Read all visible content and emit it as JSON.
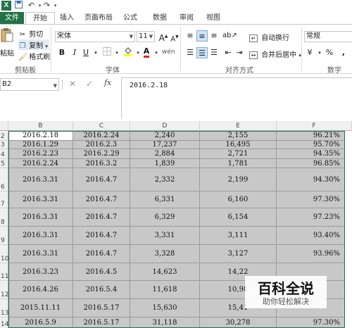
{
  "qat": {
    "undo": "↶",
    "redo": "↷"
  },
  "tabs": [
    {
      "label": "文件"
    },
    {
      "label": "开始"
    },
    {
      "label": "插入"
    },
    {
      "label": "页面布局"
    },
    {
      "label": "公式"
    },
    {
      "label": "数据"
    },
    {
      "label": "审阅"
    },
    {
      "label": "视图"
    }
  ],
  "ribbon": {
    "clipboard": {
      "paste": "粘贴",
      "cut": "剪切",
      "copy": "复制",
      "format_painter": "格式刷",
      "group": "剪贴板"
    },
    "font": {
      "name": "宋体",
      "size": "11",
      "bold": "B",
      "italic": "I",
      "underline": "U",
      "grow": "A",
      "shrink": "A",
      "group": "字体"
    },
    "alignment": {
      "wrap": "自动换行",
      "merge": "合并后居中",
      "group": "对齐方式"
    },
    "number": {
      "format": "常规",
      "currency": "¥",
      "percent": "%",
      "comma": ",",
      "group": "数字"
    }
  },
  "formula_bar": {
    "name_box": "B2",
    "fx": "fx",
    "content": "2016.2.18"
  },
  "columns": [
    "B",
    "C",
    "D",
    "E",
    "F"
  ],
  "rows": [
    {
      "n": "2",
      "cells": [
        "2016.2.18",
        "2016.2.24",
        "2,240",
        "2,155",
        "96.21%"
      ]
    },
    {
      "n": "3",
      "cells": [
        "2016.1.29",
        "2016.2.3",
        "17,237",
        "16,495",
        "95.70%"
      ]
    },
    {
      "n": "4",
      "cells": [
        "2016.2.23",
        "2016.2.29",
        "2,884",
        "2,721",
        "94.35%"
      ]
    },
    {
      "n": "5",
      "cells": [
        "2016.2.24",
        "2016.3.2",
        "1,839",
        "1,781",
        "96.85%"
      ]
    },
    {
      "n": "6",
      "cells": [
        "2016.3.31",
        "2016.4.7",
        "2,332",
        "2,199",
        "94.30%"
      ]
    },
    {
      "n": "7",
      "cells": [
        "2016.3.31",
        "2016.4.7",
        "6,331",
        "6,160",
        "97.30%"
      ]
    },
    {
      "n": "8",
      "cells": [
        "2016.3.31",
        "2016.4.7",
        "6,329",
        "6,154",
        "97.23%"
      ]
    },
    {
      "n": "9",
      "cells": [
        "2016.3.31",
        "2016.4.7",
        "3,331",
        "3,111",
        "93.40%"
      ]
    },
    {
      "n": "10",
      "cells": [
        "2016.3.31",
        "2016.4.7",
        "3,328",
        "3,127",
        "93.96%"
      ]
    },
    {
      "n": "11",
      "cells": [
        "2016.3.23",
        "2016.4.5",
        "14,623",
        "14,22",
        ""
      ]
    },
    {
      "n": "12",
      "cells": [
        "2016.4.26",
        "2016.5.4",
        "11,618",
        "10,98",
        ""
      ]
    },
    {
      "n": "13",
      "cells": [
        "2015.11.11",
        "2016.5.17",
        "15,630",
        "15,41",
        ""
      ]
    },
    {
      "n": "14",
      "cells": [
        "2016.5.9",
        "2016.5.17",
        "31,118",
        "30,278",
        "97.30%"
      ]
    }
  ],
  "watermark": {
    "title": "百科全说",
    "subtitle": "助你轻松解决"
  }
}
